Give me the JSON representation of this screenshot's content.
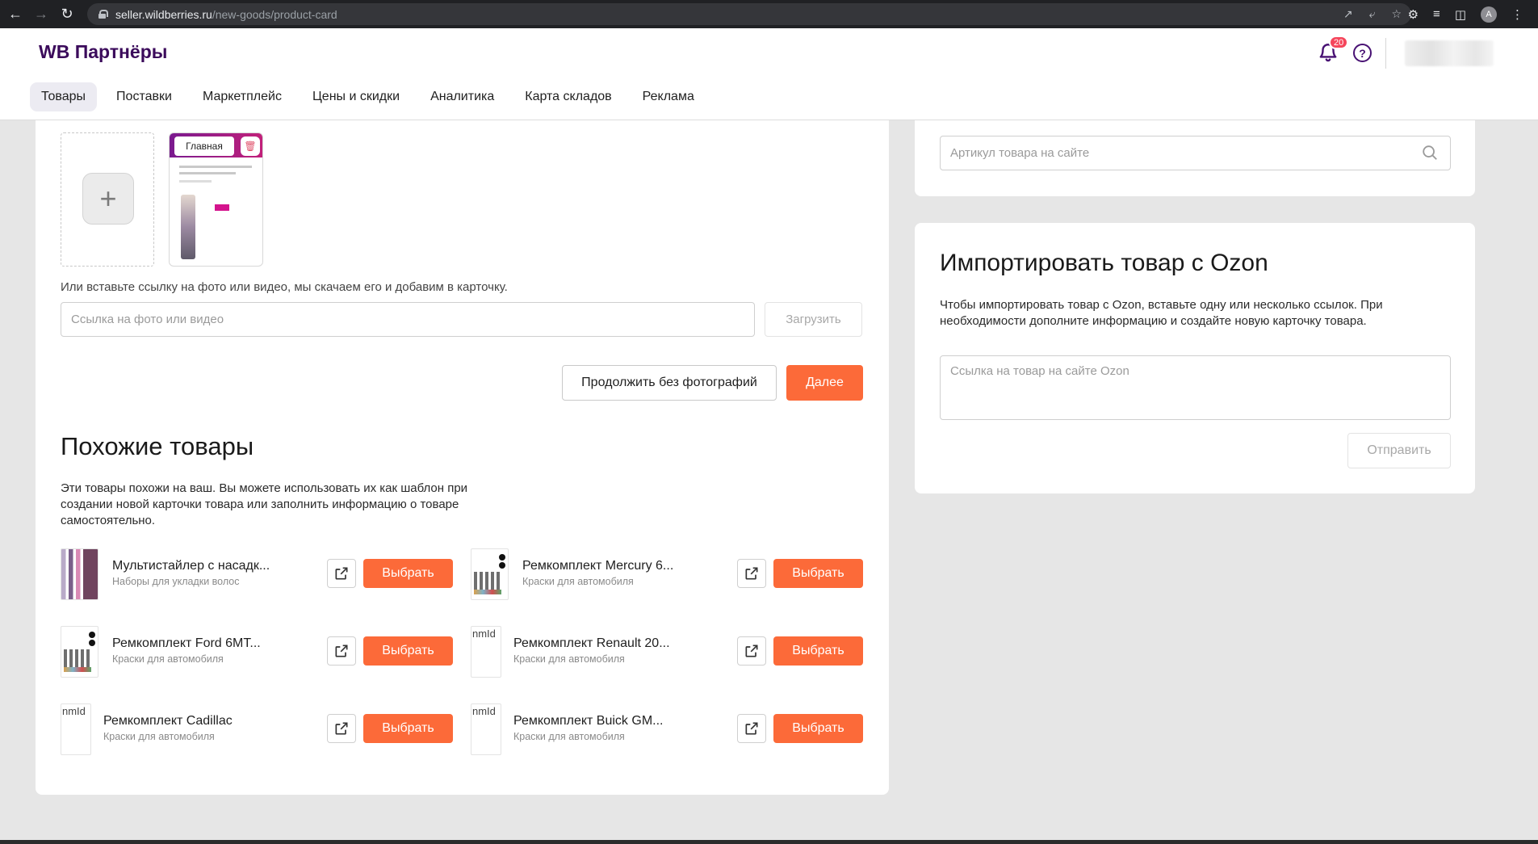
{
  "browser": {
    "url_host": "seller.wildberries.ru",
    "url_path": "/new-goods/product-card",
    "profile_initial": "A"
  },
  "header": {
    "logo": "WB Партнёры",
    "notifications_count": "20",
    "help_symbol": "?"
  },
  "tabs": [
    {
      "label": "Товары",
      "active": true
    },
    {
      "label": "Поставки"
    },
    {
      "label": "Маркетплейс"
    },
    {
      "label": "Цены и скидки"
    },
    {
      "label": "Аналитика"
    },
    {
      "label": "Карта складов"
    },
    {
      "label": "Реклама"
    }
  ],
  "photos": {
    "main_label": "Главная",
    "link_hint": "Или вставьте ссылку на фото или видео, мы скачаем его и добавим в карточку.",
    "link_placeholder": "Ссылка на фото или видео",
    "upload_label": "Загрузить",
    "continue_label": "Продолжить без фотографий",
    "next_label": "Далее"
  },
  "similar": {
    "title": "Похожие товары",
    "description": "Эти товары похожи на ваш. Вы можете использовать их как шаблон при создании новой карточки товара или заполнить информацию о товаре самостоятельно.",
    "choose_label": "Выбрать",
    "broken_image_alt": "nmId",
    "items": [
      {
        "name": "Мультистайлер с насадк...",
        "category": "Наборы для укладки волос",
        "thumb": "style"
      },
      {
        "name": "Ремкомплект Mercury 6...",
        "category": "Краски для автомобиля",
        "thumb": "repair"
      },
      {
        "name": "Ремкомплект Ford 6MT...",
        "category": "Краски для автомобиля",
        "thumb": "repair"
      },
      {
        "name": "Ремкомплект Renault 20...",
        "category": "Краски для автомобиля",
        "thumb": "broken"
      },
      {
        "name": "Ремкомплект Cadillac",
        "category": "Краски для автомобиля",
        "thumb": "broken"
      },
      {
        "name": "Ремкомплект Buick GM...",
        "category": "Краски для автомобиля",
        "thumb": "broken"
      }
    ]
  },
  "search": {
    "placeholder": "Артикул товара на сайте"
  },
  "ozon": {
    "title": "Импортировать товар с Ozon",
    "description": "Чтобы импортировать товар с Ozon, вставьте одну или несколько ссылок. При необходимости дополните информацию и создайте новую карточку товара.",
    "placeholder": "Ссылка на товар на сайте Ozon",
    "send_label": "Отправить"
  },
  "colors": {
    "accent": "#fc6a39",
    "brand": "#481173",
    "badge": "#f5455b"
  }
}
